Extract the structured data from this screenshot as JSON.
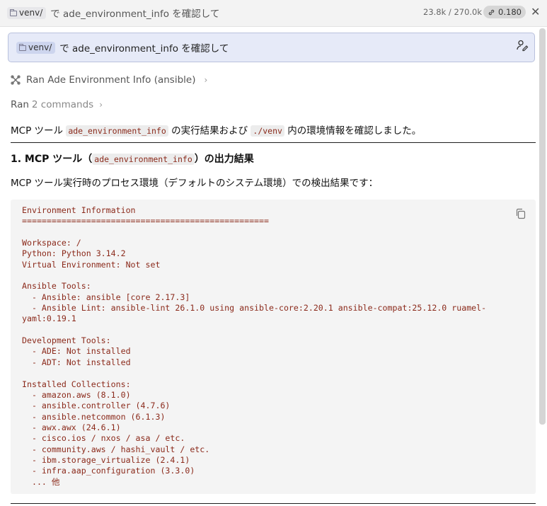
{
  "header": {
    "folder_chip": "venv/",
    "title_text": "で ade_environment_info を確認して",
    "tokens": "23.8k / 270.0k",
    "cost": "0.180",
    "close_label": "✕"
  },
  "user_message": {
    "folder_chip": "venv/",
    "text": "で ade_environment_info を確認して"
  },
  "tool_call": {
    "label": "Ran Ade Environment Info (ansible)",
    "chevron": "›"
  },
  "ran_commands": {
    "ran": "Ran",
    "count": "2 commands",
    "chevron": "›"
  },
  "intro": {
    "prefix": "MCP ツール ",
    "code1": "ade_environment_info",
    "middle": " の実行結果および ",
    "code2": "./venv",
    "suffix": " 内の環境情報を確認しました。"
  },
  "section1": {
    "prefix": "1. MCP ツール（",
    "code": "ade_environment_info",
    "suffix": "）の出力結果"
  },
  "section1_desc": "MCP ツール実行時のプロセス環境（デフォルトのシステム環境）での検出結果です：",
  "code_output": "Environment Information\n==================================================\n\nWorkspace: /\nPython: Python 3.14.2\nVirtual Environment: Not set\n\nAnsible Tools:\n  - Ansible: ansible [core 2.17.3]\n  - Ansible Lint: ansible-lint 26.1.0 using ansible-core:2.20.1 ansible-compat:25.12.0 ruamel-\nyaml:0.19.1\n\nDevelopment Tools:\n  - ADE: Not installed\n  - ADT: Not installed\n\nInstalled Collections:\n  - amazon.aws (8.1.0)\n  - ansible.controller (4.7.6)\n  - ansible.netcommon (6.1.3)\n  - awx.awx (24.6.1)\n  - cisco.ios / nxos / asa / etc.\n  - community.aws / hashi_vault / etc.\n  - ibm.storage_virtualize (2.4.1)\n  - infra.aap_configuration (3.3.0)\n  ... 他",
  "icons": {
    "folder": "folder-icon",
    "link": "link-icon",
    "close": "close-icon",
    "edit": "edit-user-icon",
    "tool": "tool-icon",
    "chevron": "chevron-right-icon",
    "copy": "copy-icon"
  }
}
